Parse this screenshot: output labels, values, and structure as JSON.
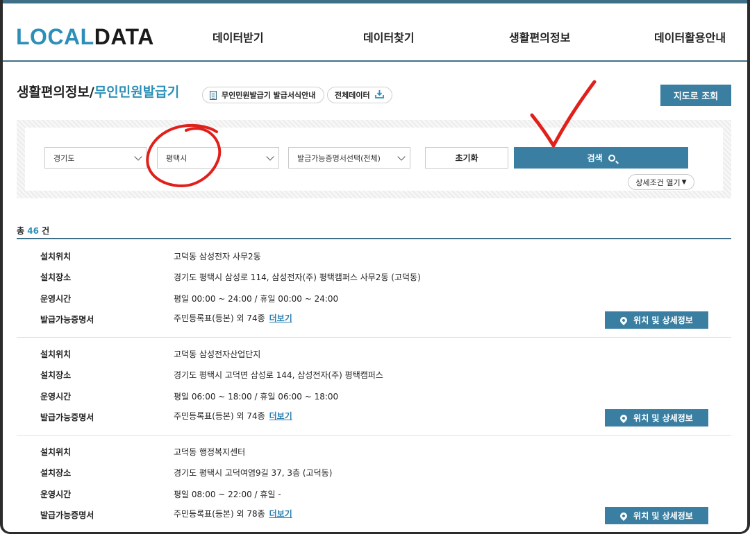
{
  "logo": {
    "part1": "LOCAL",
    "part2": "DATA"
  },
  "nav": [
    "데이터받기",
    "데이터찾기",
    "생활편의정보",
    "데이터활용안내"
  ],
  "page": {
    "title": "생활편의정보/",
    "subtitle": "무인민원발급기",
    "guide_pill": "무인민원발급기 발급서식안내",
    "download_pill": "전체데이터",
    "map_button": "지도로 조회"
  },
  "search": {
    "province": "경기도",
    "city": "평택시",
    "certificate": "발급가능증명서선택(전체)",
    "reset_label": "초기화",
    "search_label": "검색",
    "detail_toggle": "상세조건 열기"
  },
  "total": {
    "prefix": "총",
    "count": "46",
    "suffix": "건"
  },
  "labels": {
    "location": "설치위치",
    "place": "설치장소",
    "hours": "운영시간",
    "certs": "발급가능증명서",
    "more": "더보기",
    "detail_button": "위치 및 상세정보"
  },
  "results": [
    {
      "location": "고덕동 삼성전자 사무2동",
      "place": "경기도 평택시 삼성로 114, 삼성전자(주) 평택캠퍼스 사무2동 (고덕동)",
      "hours": "평일 00:00 ~ 24:00 / 휴일 00:00 ~ 24:00",
      "certs": "주민등록표(등본) 외 74종"
    },
    {
      "location": "고덕동 삼성전자산업단지",
      "place": "경기도 평택시 고덕면 삼성로 144, 삼성전자(주) 평택캠퍼스",
      "hours": "평일 06:00 ~ 18:00 / 휴일 06:00 ~ 18:00",
      "certs": "주민등록표(등본) 외 74종"
    },
    {
      "location": "고덕동 행정복지센터",
      "place": "경기도 평택시 고덕여염9길 37, 3층 (고덕동)",
      "hours": "평일 08:00 ~ 22:00 / 휴일 -",
      "certs": "주민등록표(등본) 외 78종"
    }
  ],
  "colors": {
    "accent": "#3a7fa2",
    "brand_blue": "#2b8fb8",
    "annotation_red": "#e0201b"
  }
}
